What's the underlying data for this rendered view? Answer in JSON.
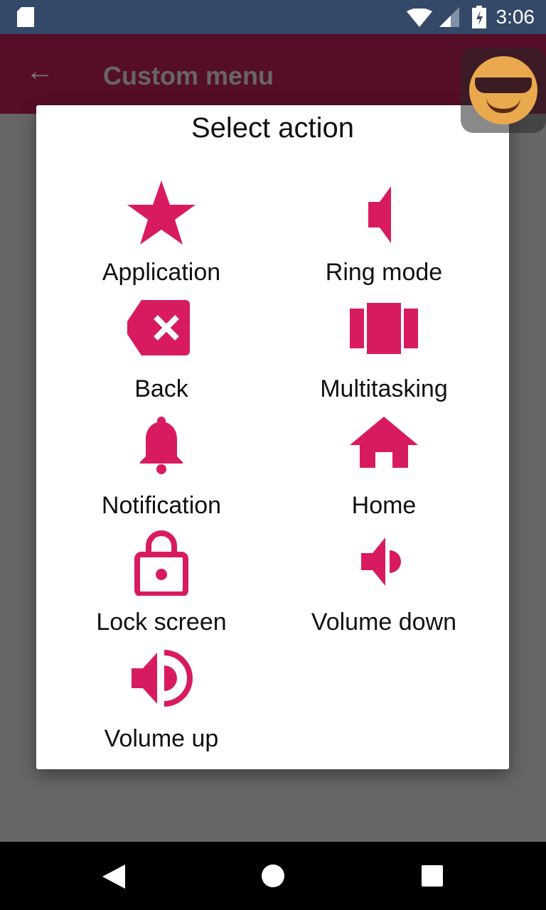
{
  "status_bar": {
    "time": "3:06"
  },
  "app_bar": {
    "title": "Custom menu"
  },
  "dialog": {
    "title": "Select action",
    "accent": "#d81b60",
    "items": [
      {
        "label": "Application",
        "icon": "star-icon"
      },
      {
        "label": "Ring mode",
        "icon": "speaker-icon"
      },
      {
        "label": "Back",
        "icon": "backspace-icon"
      },
      {
        "label": "Multitasking",
        "icon": "carousel-icon"
      },
      {
        "label": "Notification",
        "icon": "bell-icon"
      },
      {
        "label": "Home",
        "icon": "home-icon"
      },
      {
        "label": "Lock screen",
        "icon": "lock-icon"
      },
      {
        "label": "Volume down",
        "icon": "volume-down-icon"
      },
      {
        "label": "Volume up",
        "icon": "volume-up-icon"
      }
    ]
  }
}
